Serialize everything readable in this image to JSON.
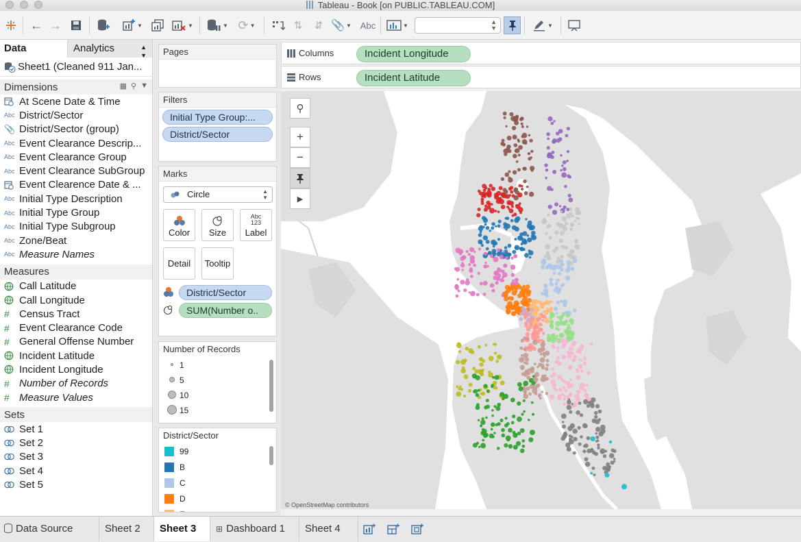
{
  "window": {
    "title": "Tableau - Book [on PUBLIC.TABLEAU.COM]"
  },
  "data_pane": {
    "tabs": [
      "Data",
      "Analytics"
    ],
    "datasource": "Sheet1 (Cleaned 911 Jan...",
    "dimensions_header": "Dimensions",
    "dimensions": [
      {
        "label": "At Scene Date & Time",
        "icon": "date-time-icon"
      },
      {
        "label": "District/Sector",
        "icon": "abc-icon"
      },
      {
        "label": "District/Sector (group)",
        "icon": "paperclip-icon"
      },
      {
        "label": "Event Clearance Descrip...",
        "icon": "abc-icon"
      },
      {
        "label": "Event Clearance Group",
        "icon": "abc-icon"
      },
      {
        "label": "Event Clearance SubGroup",
        "icon": "abc-icon"
      },
      {
        "label": "Event Clearence Date & ...",
        "icon": "date-time-icon"
      },
      {
        "label": "Initial Type Description",
        "icon": "abc-icon"
      },
      {
        "label": "Initial Type Group",
        "icon": "abc-icon"
      },
      {
        "label": "Initial Type Subgroup",
        "icon": "abc-icon"
      },
      {
        "label": "Zone/Beat",
        "icon": "abc-icon"
      },
      {
        "label": "Measure Names",
        "icon": "abc-icon"
      }
    ],
    "measures_header": "Measures",
    "measures": [
      {
        "label": "Call Latitude",
        "icon": "globe-icon"
      },
      {
        "label": "Call Longitude",
        "icon": "globe-icon"
      },
      {
        "label": "Census Tract",
        "icon": "hash-icon"
      },
      {
        "label": "Event Clearance Code",
        "icon": "hash-icon"
      },
      {
        "label": "General Offense Number",
        "icon": "hash-icon"
      },
      {
        "label": "Incident Latitude",
        "icon": "globe-icon"
      },
      {
        "label": "Incident Longitude",
        "icon": "globe-icon"
      },
      {
        "label": "Number of Records",
        "icon": "hash-icon"
      },
      {
        "label": "Measure Values",
        "icon": "hash-icon"
      }
    ],
    "sets_header": "Sets",
    "sets": [
      {
        "label": "Set 1",
        "icon": "set-icon"
      },
      {
        "label": "Set 2",
        "icon": "set-icon"
      },
      {
        "label": "Set 3",
        "icon": "set-icon"
      },
      {
        "label": "Set 4",
        "icon": "set-icon"
      },
      {
        "label": "Set 5",
        "icon": "set-icon"
      }
    ]
  },
  "cards": {
    "pages": "Pages",
    "filters": "Filters",
    "filter_pills": [
      "Initial Type Group:...",
      "District/Sector"
    ],
    "marks": "Marks",
    "mark_type": "Circle",
    "mark_buttons": [
      "Color",
      "Size",
      "Label",
      "Detail",
      "Tooltip"
    ],
    "label_icon_text": [
      "Abc",
      "123"
    ],
    "mark_pills": [
      "District/Sector",
      "SUM(Number o.."
    ],
    "size_legend_title": "Number of Records",
    "size_legend": [
      "1",
      "5",
      "10",
      "15"
    ],
    "color_legend_title": "District/Sector",
    "color_legend": [
      {
        "label": "99",
        "color": "#17becf"
      },
      {
        "label": "B",
        "color": "#1f77b4"
      },
      {
        "label": "C",
        "color": "#aec7e8"
      },
      {
        "label": "D",
        "color": "#ff7f0e"
      },
      {
        "label": "E",
        "color": "#ffbb78"
      }
    ]
  },
  "shelves": {
    "columns_label": "Columns",
    "columns_pill": "Incident Longitude",
    "rows_label": "Rows",
    "rows_pill": "Incident Latitude"
  },
  "map": {
    "credit": "© OpenStreetMap contributors",
    "tools": [
      "search-icon",
      "zoom-in-icon",
      "zoom-out-icon",
      "pin-icon",
      "expand-icon"
    ],
    "colors": {
      "land": "#e0e0e0",
      "water": "#ffffff",
      "park": "#d6d6d6"
    }
  },
  "bottom_tabs": [
    "Data Source",
    "Sheet 2",
    "Sheet 3",
    "Dashboard 1",
    "Sheet 4"
  ],
  "active_tab": "Sheet 3"
}
